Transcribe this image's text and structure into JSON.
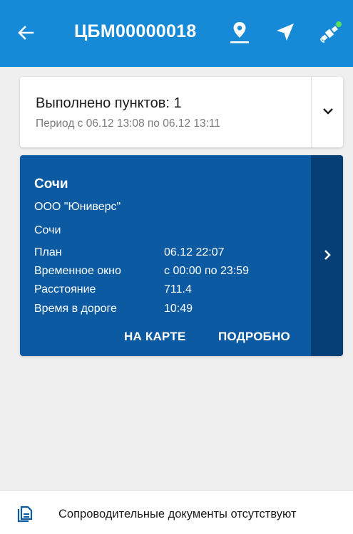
{
  "appbar": {
    "title": "ЦБМ00000018",
    "back_icon": "arrow-left-icon",
    "icons": [
      "location-pin-icon",
      "navigation-arrow-icon",
      "satellite-icon"
    ],
    "status_dot_color": "#5de05d",
    "background_color": "#1689d7"
  },
  "summary": {
    "completed": "Выполнено пунктов: 1",
    "period": "Период с 06.12 13:08 по 06.12 13:11"
  },
  "point": {
    "city": "Сочи",
    "company": "ООО \"Юниверс\"",
    "address": "Сочи",
    "rows": [
      {
        "label": "План",
        "value": "06.12 22:07"
      },
      {
        "label": "Временное окно",
        "value": "с 00:00 по 23:59"
      },
      {
        "label": "Расстояние",
        "value": "711.4"
      },
      {
        "label": "Время в дороге",
        "value": "10:49"
      }
    ],
    "map_button": "НА КАРТЕ",
    "details_button": "ПОДРОБНО",
    "card_color": "#0b5aa2"
  },
  "footer": {
    "documents_text": "Сопроводительные документы отсутствуют"
  }
}
